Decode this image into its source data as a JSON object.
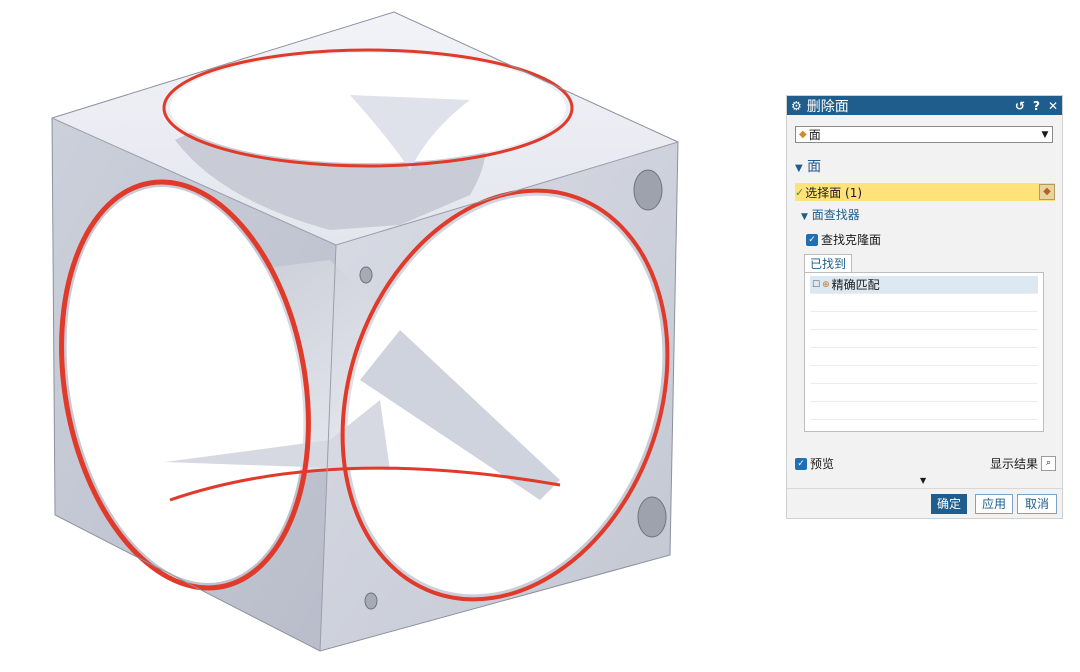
{
  "dialog": {
    "title": "删除面",
    "title_icons": [
      "settings-icon",
      "reset-icon",
      "help-icon",
      "close-icon"
    ],
    "reset_glyph": "↺",
    "help_glyph": "?",
    "close_glyph": "✕",
    "type_dropdown": {
      "selected": "面"
    },
    "section_label": "面",
    "select_face": {
      "label": "选择面 (1)"
    },
    "finder": {
      "label": "面查找器",
      "find_clones": {
        "label": "查找克隆面",
        "checked": true
      },
      "tab_label": "已找到",
      "results": [
        {
          "label": "精确匹配",
          "checked": false
        }
      ]
    },
    "preview": {
      "label": "预览",
      "checked": true
    },
    "show_result_label": "显示结果",
    "buttons": {
      "ok": "确定",
      "apply": "应用",
      "cancel": "取消"
    }
  },
  "colors": {
    "title_bar": "#1f5e8c",
    "highlight_row": "#ffe27a",
    "accent": "#1f6fb5",
    "model_edge_highlight": "#e03a2a",
    "model_face": "#e9ecf3"
  }
}
